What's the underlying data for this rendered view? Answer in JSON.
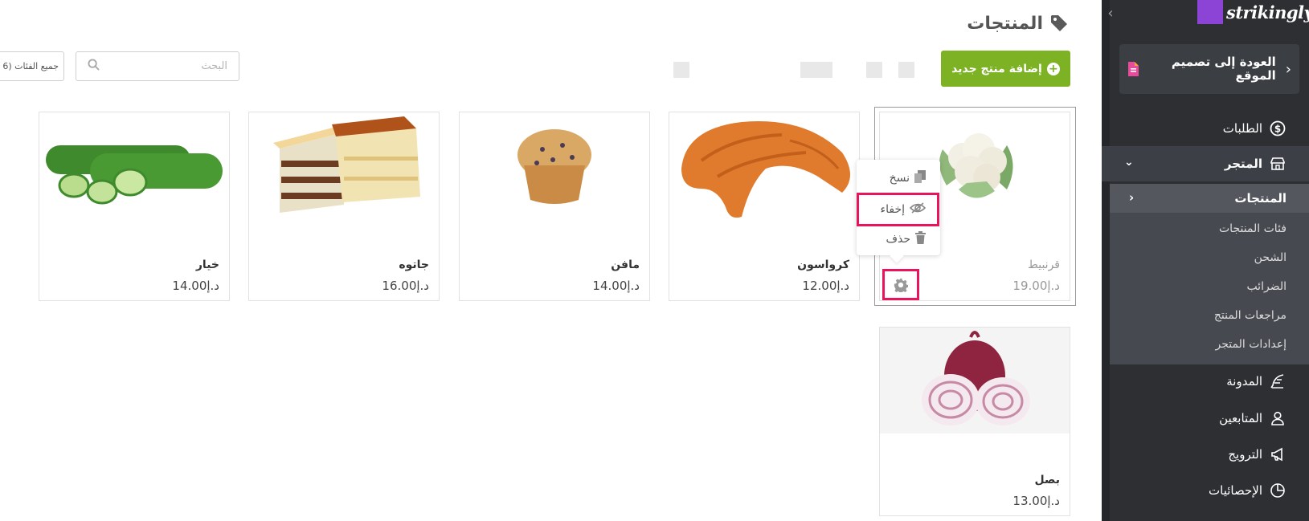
{
  "app": {
    "logo_text": "strikingly",
    "brand_color": "#8b44d6"
  },
  "sidebar": {
    "back_label": "العودة إلى تصميم الموقع",
    "items": {
      "orders": "الطلبات",
      "store": "المتجر",
      "blog": "المدونة",
      "followers": "المتابعين",
      "promote": "الترويج",
      "stats": "الإحصائيات"
    },
    "store_sub": {
      "products": "المنتجات",
      "categories": "فئات المنتجات",
      "shipping": "الشحن",
      "taxes": "الضرائب",
      "reviews": "مراجعات المنتج",
      "settings": "إعدادات المتجر"
    }
  },
  "header": {
    "title": "المنتجات",
    "add_button": "إضافة منتج جديد"
  },
  "toolbar": {
    "search_placeholder": "البحث",
    "category_filter": "جميع الفئات (6"
  },
  "products": [
    {
      "name": "قرنبيط",
      "price": "د.إ19.00",
      "hidden": true
    },
    {
      "name": "كرواسون",
      "price": "د.إ12.00"
    },
    {
      "name": "مافن",
      "price": "د.إ14.00"
    },
    {
      "name": "جاتوه",
      "price": "د.إ16.00"
    },
    {
      "name": "خيار",
      "price": "د.إ14.00"
    },
    {
      "name": "بصل",
      "price": "د.إ13.00"
    }
  ],
  "context_menu": {
    "copy": "نسخ",
    "hide": "إخفاء",
    "delete": "حذف"
  },
  "colors": {
    "accent_green": "#7db224",
    "highlight": "#e8155d",
    "sidebar_bg": "#2d2f33"
  }
}
